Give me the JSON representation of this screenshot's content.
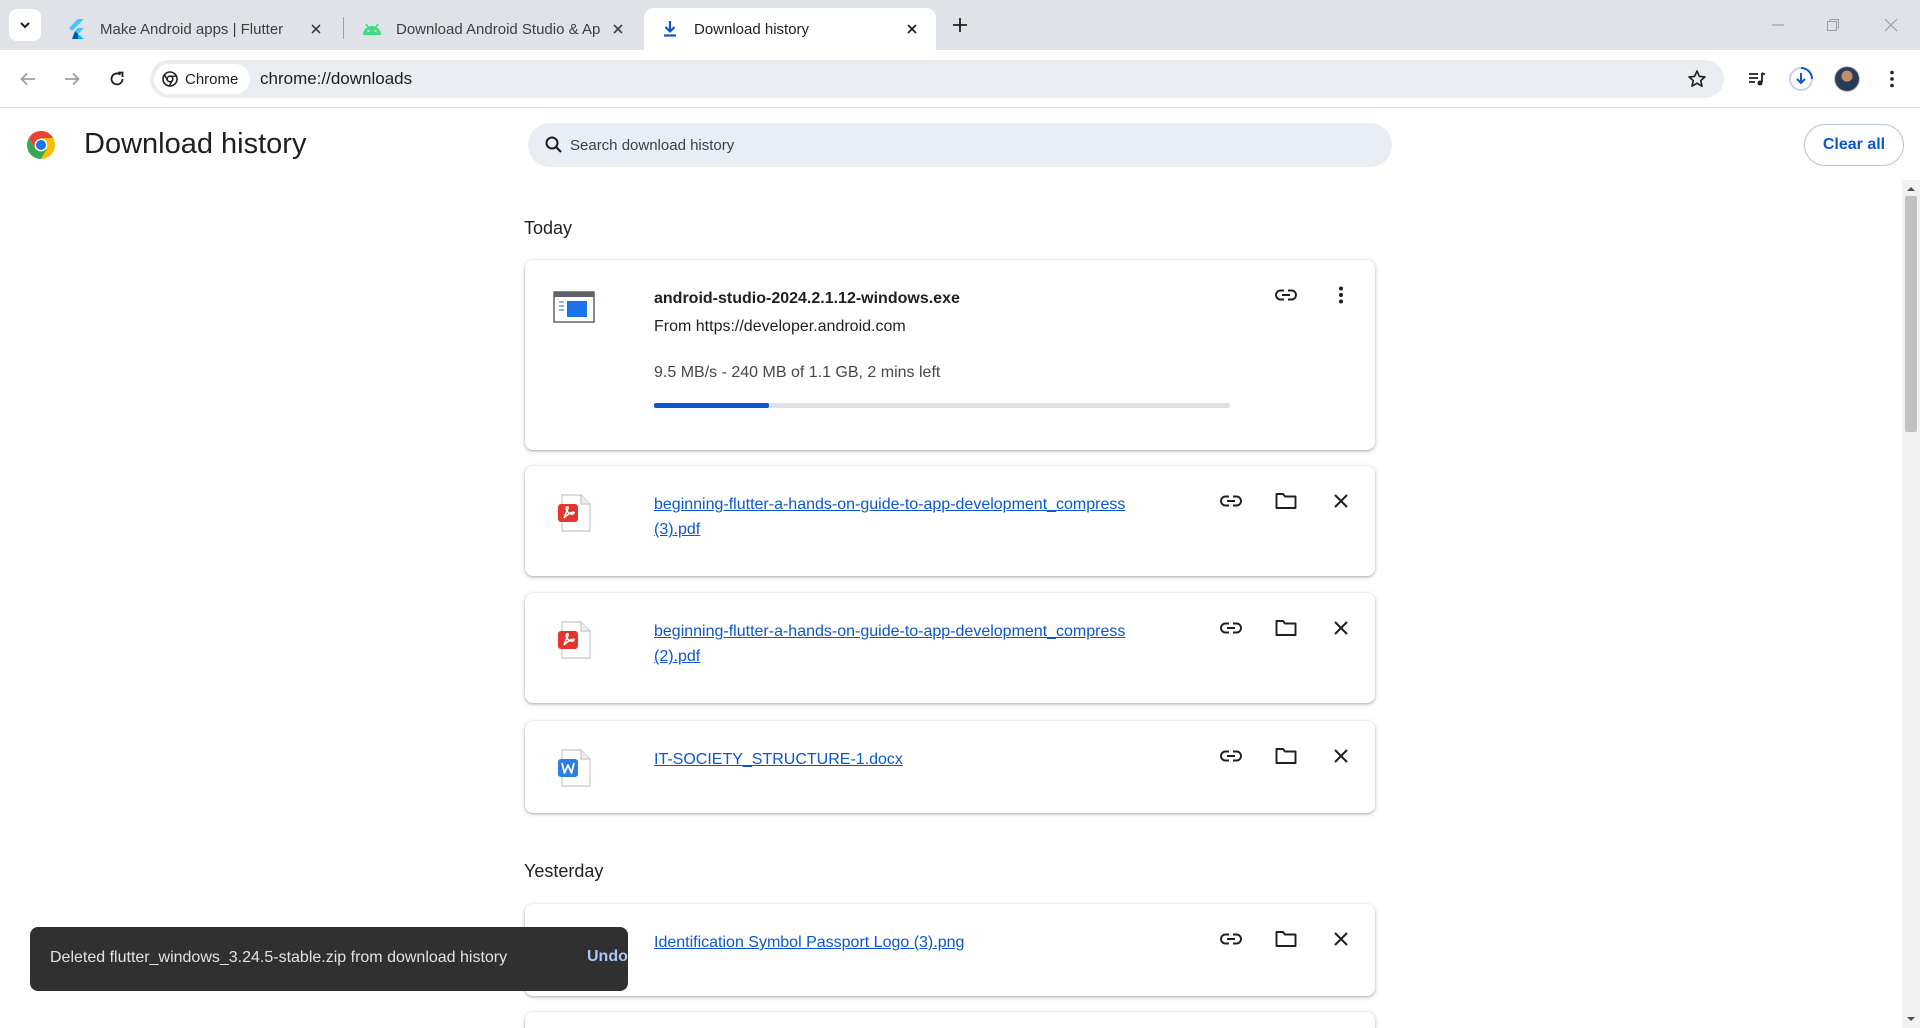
{
  "tabs": [
    {
      "title": "Make Android apps | Flutter",
      "icon": "flutter-icon"
    },
    {
      "title": "Download Android Studio & Ap",
      "icon": "android-icon"
    },
    {
      "title": "Download history",
      "icon": "download-icon",
      "active": true
    }
  ],
  "omnibox": {
    "chip_label": "Chrome",
    "url": "chrome://downloads"
  },
  "page": {
    "title": "Download history",
    "search_placeholder": "Search download history",
    "clear_all_label": "Clear all"
  },
  "sections": {
    "today": "Today",
    "yesterday": "Yesterday"
  },
  "downloads": [
    {
      "name": "android-studio-2024.2.1.12-windows.exe",
      "from_label": "From",
      "from_url": "https://developer.android.com",
      "status": "9.5 MB/s - 240 MB of 1.1 GB, 2 mins left",
      "progress_fraction": 0.2,
      "icon": "exe-file-icon",
      "in_progress": true
    },
    {
      "name_line1": "beginning-flutter-a-hands-on-guide-to-app-development_compress",
      "name_line2": "(3).pdf",
      "icon": "pdf-file-icon"
    },
    {
      "name_line1": "beginning-flutter-a-hands-on-guide-to-app-development_compress",
      "name_line2": "(2).pdf",
      "icon": "pdf-file-icon"
    },
    {
      "name_line1": "IT-SOCIETY_STRUCTURE-1.docx",
      "icon": "word-file-icon"
    },
    {
      "name_line1": "Identification Symbol Passport Logo (3).png",
      "icon": "image-file-icon"
    }
  ],
  "toast": {
    "message": "Deleted flutter_windows_3.24.5-stable.zip from download history",
    "action": "Undo"
  },
  "colors": {
    "accent": "#0b57d0",
    "tabstrip_bg": "#dfe3e7",
    "omnibox_bg": "#e9edf1",
    "toast_bg": "#303030",
    "pdf_red": "#e5352c",
    "word_blue": "#2a7de1"
  }
}
